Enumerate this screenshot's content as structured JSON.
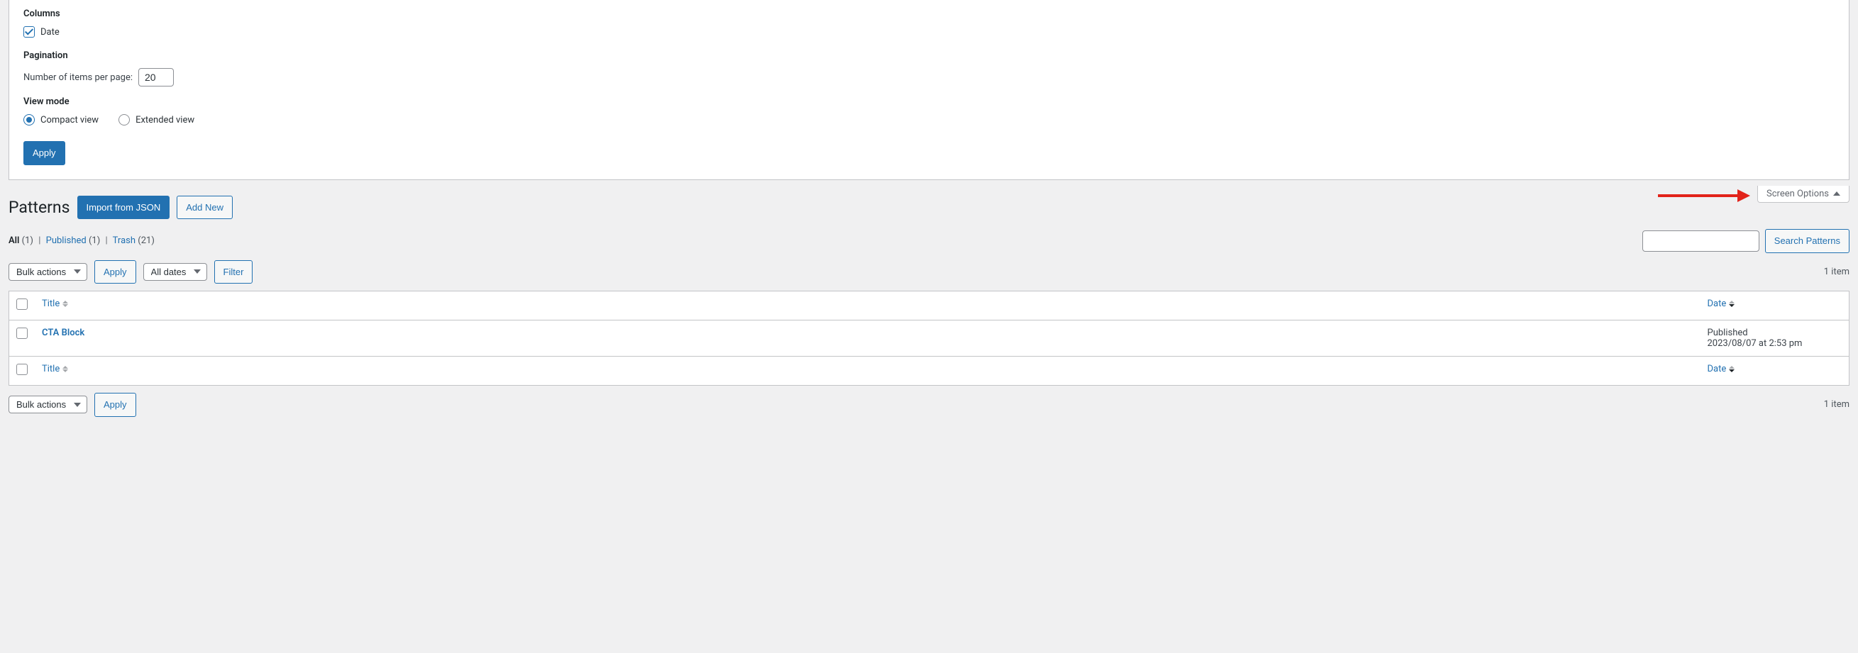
{
  "screenOptions": {
    "columnsLabel": "Columns",
    "dateColumnLabel": "Date",
    "dateChecked": true,
    "paginationLabel": "Pagination",
    "itemsPerPageLabel": "Number of items per page:",
    "itemsPerPage": "20",
    "viewModeLabel": "View mode",
    "compactLabel": "Compact view",
    "extendedLabel": "Extended view",
    "viewMode": "compact",
    "applyLabel": "Apply",
    "tabLabel": "Screen Options"
  },
  "header": {
    "pageTitle": "Patterns",
    "importButton": "Import from JSON",
    "addNewButton": "Add New"
  },
  "filters": {
    "allLabel": "All",
    "allCount": "(1)",
    "publishedLabel": "Published",
    "publishedCount": "(1)",
    "trashLabel": "Trash",
    "trashCount": "(21)"
  },
  "search": {
    "value": "",
    "buttonLabel": "Search Patterns"
  },
  "bulk": {
    "bulkActionsOption": "Bulk actions",
    "applyLabel": "Apply",
    "allDatesOption": "All dates",
    "filterLabel": "Filter"
  },
  "table": {
    "titleHeader": "Title",
    "dateHeader": "Date",
    "itemCountText": "1 item",
    "rows": [
      {
        "title": "CTA Block",
        "status": "Published",
        "datetime": "2023/08/07 at 2:53 pm"
      }
    ]
  }
}
